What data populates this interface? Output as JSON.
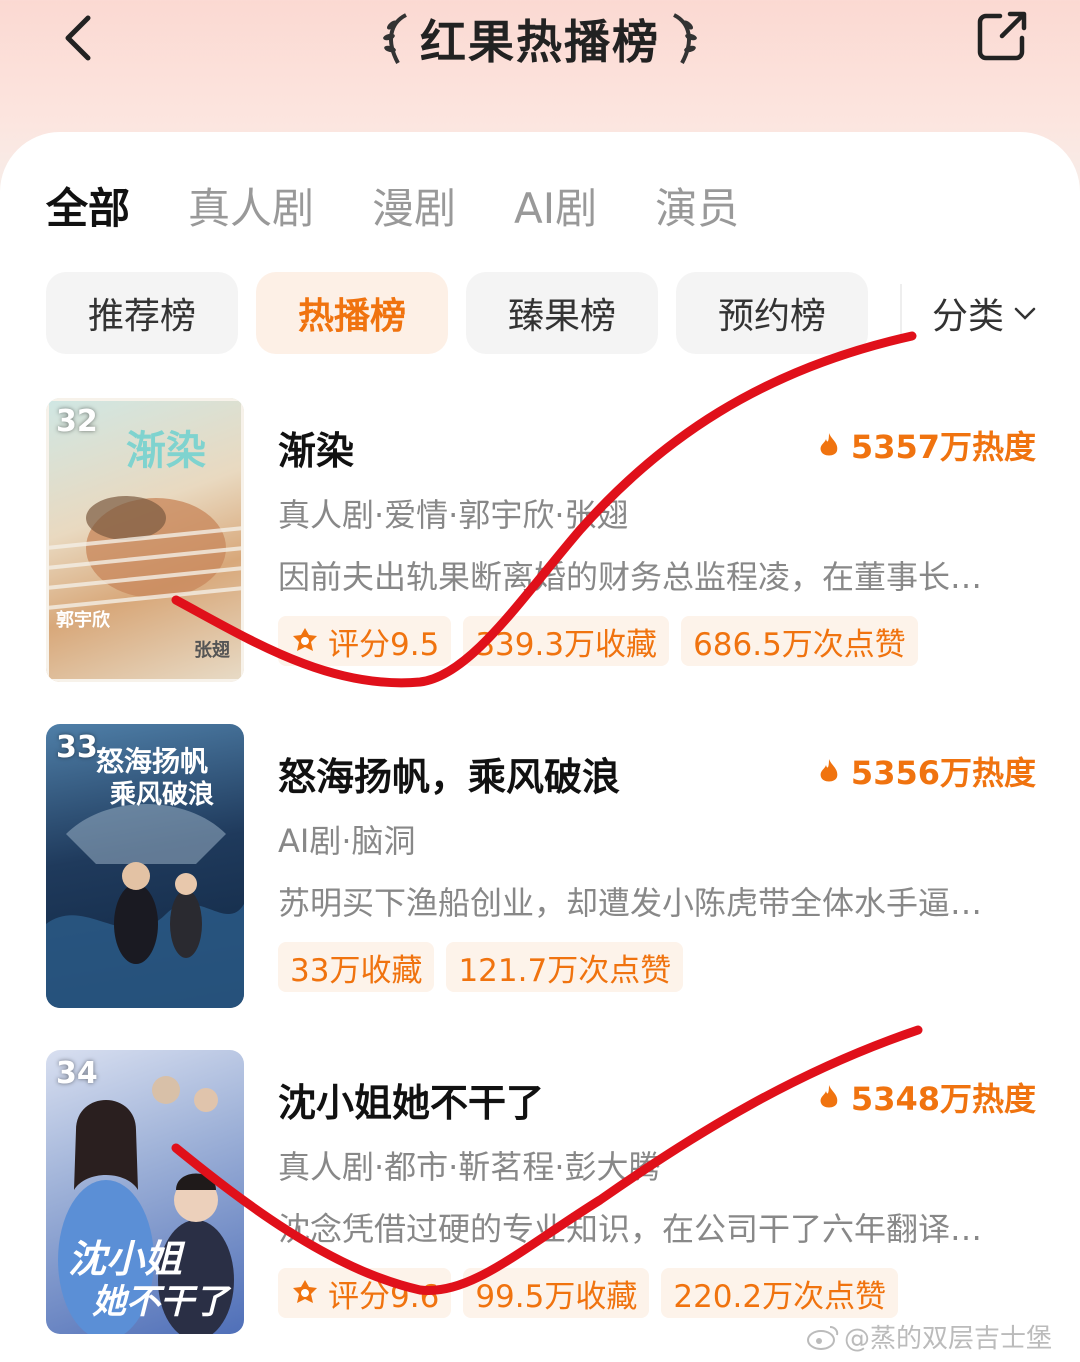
{
  "header": {
    "title": "红果热播榜"
  },
  "tabs": [
    {
      "label": "全部",
      "active": true
    },
    {
      "label": "真人剧"
    },
    {
      "label": "漫剧"
    },
    {
      "label": "AI剧"
    },
    {
      "label": "演员"
    }
  ],
  "chips": [
    {
      "label": "推荐榜"
    },
    {
      "label": "热播榜",
      "active": true
    },
    {
      "label": "臻果榜"
    },
    {
      "label": "预约榜"
    }
  ],
  "sort": {
    "label": "分类"
  },
  "items": [
    {
      "rank": "32",
      "title": "渐染",
      "heat": "5357万热度",
      "meta": "真人剧·爱情·郭宇欣·张翅",
      "desc": "因前夫出轨果断离婚的财务总监程凌，在董事长…",
      "tags": [
        "评分9.5",
        "339.3万收藏",
        "686.5万次点赞"
      ],
      "poster": {
        "title": "渐染",
        "name_left": "郭宇欣",
        "name_right": "张翅"
      }
    },
    {
      "rank": "33",
      "title": "怒海扬帆，乘风破浪",
      "heat": "5356万热度",
      "meta": "AI剧·脑洞",
      "desc": "苏明买下渔船创业，却遭发小陈虎带全体水手逼…",
      "tags": [
        "33万收藏",
        "121.7万次点赞"
      ],
      "poster": {
        "title_line1": "怒海扬帆",
        "title_line2": "乘风破浪"
      }
    },
    {
      "rank": "34",
      "title": "沈小姐她不干了",
      "heat": "5348万热度",
      "meta": "真人剧·都市·靳茗程·彭大腾",
      "desc": "沈念凭借过硬的专业知识，在公司干了六年翻译…",
      "tags": [
        "评分9.6",
        "99.5万收藏",
        "220.2万次点赞"
      ],
      "poster": {
        "title_line1": "沈小姐",
        "title_line2": "她不干了"
      }
    }
  ],
  "watermark": "@蒸的双层吉士堡",
  "colors": {
    "accent": "#f0730f",
    "annotation_red": "#e0101a"
  }
}
